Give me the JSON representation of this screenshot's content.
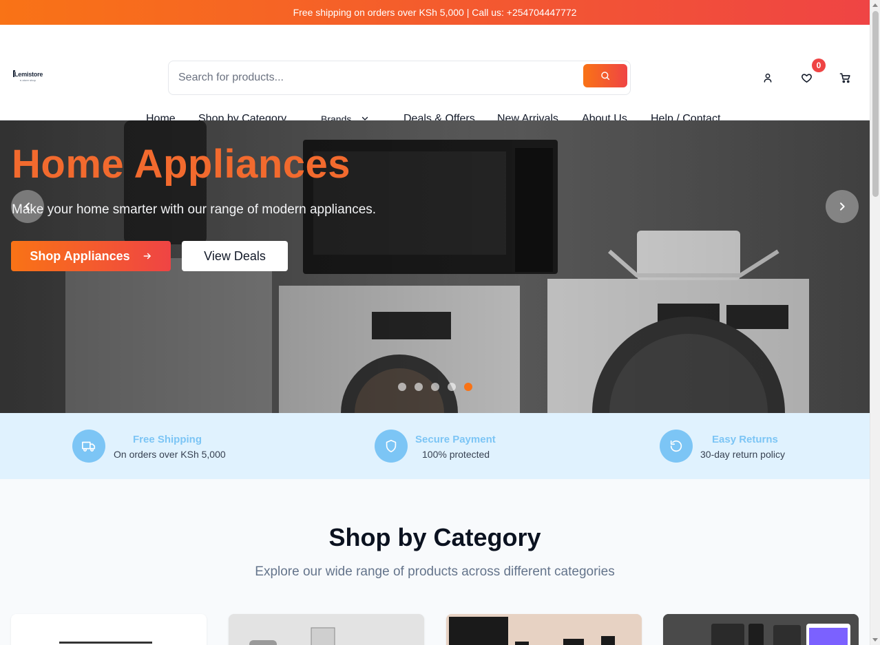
{
  "topbar": {
    "text": "Free shipping on orders over KSh 5,000 | Call us: +254704447772"
  },
  "header": {
    "logo_text": "Lemistore",
    "logo_sub": "e-store shop",
    "search_placeholder": "Search for products...",
    "wishlist_count": "0",
    "icons": [
      "user-icon",
      "heart-icon",
      "cart-icon",
      "search-icon"
    ]
  },
  "nav": {
    "items": [
      "Home",
      "Shop by Category",
      "Brands",
      "Deals & Offers",
      "New Arrivals",
      "About Us",
      "Help / Contact"
    ]
  },
  "hero": {
    "title": "Home Appliances",
    "subtitle": "Make your home smarter with our range of modern appliances.",
    "primary_cta": "Shop Appliances",
    "secondary_cta": "View Deals",
    "slides_total": 5,
    "active_slide": 5
  },
  "features": [
    {
      "title": "Free Shipping",
      "desc": "On orders over KSh 5,000",
      "icon": "truck-icon"
    },
    {
      "title": "Secure Payment",
      "desc": "100% protected",
      "icon": "shield-icon"
    },
    {
      "title": "Easy Returns",
      "desc": "30-day return policy",
      "icon": "return-icon"
    }
  ],
  "categories": {
    "title": "Shop by Category",
    "subtitle": "Explore our wide range of products across different categories"
  },
  "colors": {
    "accent_start": "#f97316",
    "accent_end": "#ef4444",
    "feature_blue": "#7cc5f5",
    "feature_bg": "#e0f2fe"
  }
}
